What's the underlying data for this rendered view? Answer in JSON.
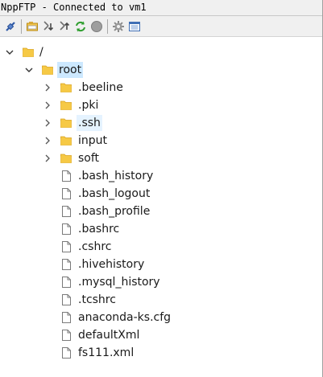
{
  "window": {
    "title": "NppFTP - Connected to vm1"
  },
  "toolbar": {
    "buttons": [
      {
        "name": "connect-icon"
      },
      {
        "name": "settings-icon"
      },
      {
        "name": "download-icon"
      },
      {
        "name": "upload-icon"
      },
      {
        "name": "refresh-icon"
      },
      {
        "name": "abort-icon"
      },
      {
        "name": "gear-icon"
      },
      {
        "name": "messages-icon"
      }
    ]
  },
  "tree": {
    "root_label": "/",
    "root_dir_label": "root",
    "folders": [
      ".beeline",
      ".pki",
      ".ssh",
      "input",
      "soft"
    ],
    "files": [
      ".bash_history",
      ".bash_logout",
      ".bash_profile",
      ".bashrc",
      ".cshrc",
      ".hivehistory",
      ".mysql_history",
      ".tcshrc",
      "anaconda-ks.cfg",
      "defaultXml",
      "fs111.xml"
    ]
  },
  "colors": {
    "folder": "#f6c945",
    "selection": "#cce8ff",
    "hover": "#e5f3ff"
  }
}
